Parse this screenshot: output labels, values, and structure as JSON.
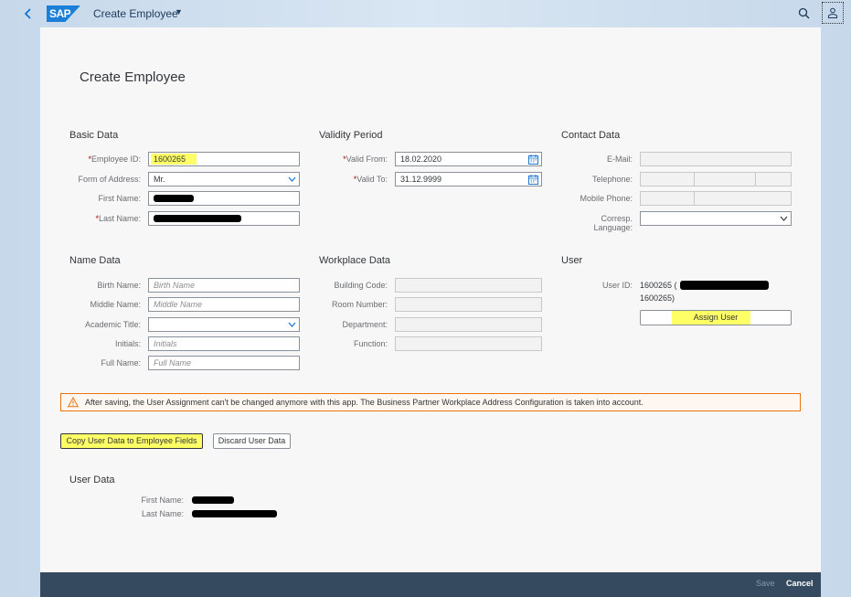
{
  "shell": {
    "logo_text": "SAP",
    "app_title": "Create Employee",
    "back_icon": "back-icon",
    "search_icon": "search-icon",
    "user_icon": "user-icon"
  },
  "page": {
    "title": "Create Employee"
  },
  "basic_data": {
    "title": "Basic Data",
    "employee_id_label": "Employee ID:",
    "employee_id_value": "1600265",
    "form_of_address_label": "Form of Address:",
    "form_of_address_value": "Mr.",
    "first_name_label": "First Name:",
    "last_name_label": "Last Name:"
  },
  "validity": {
    "title": "Validity Period",
    "valid_from_label": "Valid From:",
    "valid_from_value": "18.02.2020",
    "valid_to_label": "Valid To:",
    "valid_to_value": "31.12.9999"
  },
  "contact": {
    "title": "Contact Data",
    "email_label": "E-Mail:",
    "telephone_label": "Telephone:",
    "mobile_label": "Mobile Phone:",
    "language_label_1": "Corresp.",
    "language_label_2": "Language:"
  },
  "name_data": {
    "title": "Name Data",
    "birth_name_label": "Birth Name:",
    "birth_name_placeholder": "Birth Name",
    "middle_name_label": "Middle Name:",
    "middle_name_placeholder": "Middle Name",
    "academic_title_label": "Academic Title:",
    "initials_label": "Initials:",
    "initials_placeholder": "Initials",
    "full_name_label": "Full Name:",
    "full_name_placeholder": "Full Name"
  },
  "workplace": {
    "title": "Workplace Data",
    "building_label": "Building Code:",
    "room_label": "Room Number:",
    "department_label": "Department:",
    "function_label": "Function:"
  },
  "user": {
    "title": "User",
    "user_id_label": "User ID:",
    "user_id_line1": "1600265 (",
    "user_id_line2": "1600265)",
    "assign_button": "Assign User"
  },
  "warning": {
    "text": "After saving, the User Assignment can't be changed anymore with this app. The Business Partner Workplace Address Configuration is taken into account.",
    "icon": "warning-icon"
  },
  "actions": {
    "copy_button": "Copy User Data to Employee Fields",
    "discard_button": "Discard User Data"
  },
  "user_data": {
    "title": "User Data",
    "first_name_label": "First Name:",
    "last_name_label": "Last Name:"
  },
  "footer": {
    "save": "Save",
    "cancel": "Cancel"
  },
  "colors": {
    "accent": "#0a6ed1",
    "highlight": "#ffff66",
    "footer_bg": "#354a5f",
    "warning_border": "#e9730c"
  }
}
